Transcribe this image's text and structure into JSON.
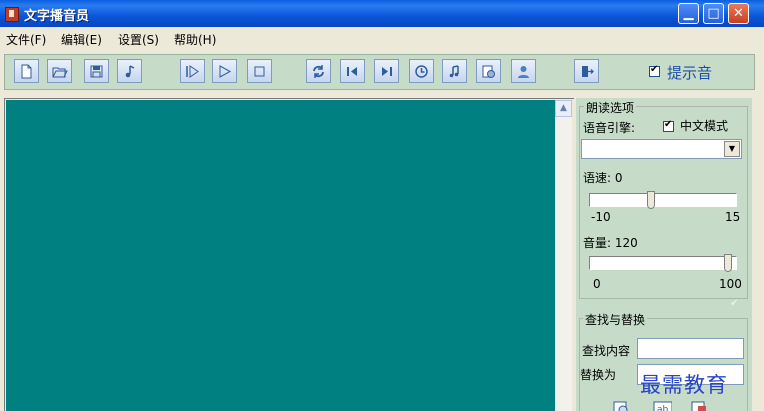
{
  "window": {
    "title": "文字播音员",
    "min_glyph": "▁",
    "max_glyph": "□",
    "close_glyph": "✕"
  },
  "menu": [
    {
      "label": "文件(F)"
    },
    {
      "label": "编辑(E)"
    },
    {
      "label": "设置(S)"
    },
    {
      "label": "帮助(H)"
    }
  ],
  "toolbar": {
    "buttons": [
      "new-file-icon",
      "open-folder-icon",
      "save-icon",
      "music-note-icon",
      "play-from-cursor-icon",
      "play-icon",
      "stop-icon",
      "repeat-icon",
      "previous-icon",
      "next-icon",
      "clock-icon",
      "music-icon",
      "image-doc-icon",
      "user-icon",
      "exit-icon"
    ],
    "prompt_sound_label": "提示音",
    "prompt_sound_checked": true
  },
  "reading": {
    "title": "朗读选项",
    "engine_label": "语音引擎:",
    "chinese_mode_label": "中文模式",
    "chinese_mode_checked": true,
    "engine_value": "",
    "speed_label": "语速: 0",
    "speed_min": "-10",
    "speed_max": "15",
    "speed_value": 0,
    "volume_label": "音量: 120",
    "volume_min": "0",
    "volume_max": "100",
    "collapse_glyph": "✔"
  },
  "find_replace": {
    "title": "查找与替换",
    "find_label": "查找内容",
    "replace_label": "替换为",
    "find_value": "",
    "replace_value": ""
  },
  "watermark": "最需教育",
  "colors": {
    "text_area": "#008080",
    "panel": "#c6dcc9",
    "accent": "#1b4fa8"
  }
}
